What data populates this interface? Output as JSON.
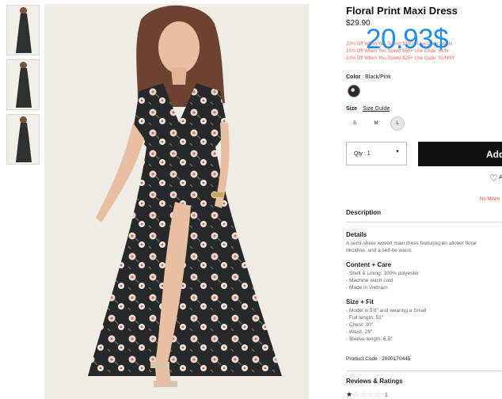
{
  "gallery": {
    "thumbnail_count": 3
  },
  "product": {
    "title": "Floral Print Maxi Dress",
    "price": "$29.90",
    "overlay_price": "20.93$",
    "promos": [
      "20% Off When You Spend $100+ Use Code: MAXI",
      "15% Off When You Spend $50+ Use Code: SUN",
      "10% Off When You Spend $25+ Use Code: SUNNY"
    ],
    "color_label": "Color",
    "color_value": ": Black/Pink",
    "size_label": "Size",
    "size_guide": "Size Guide",
    "sizes": [
      "S",
      "M",
      "L"
    ],
    "selected_size": "L",
    "quantity": "Qty : 1",
    "add_button": "Add",
    "wishlist_label": "A",
    "no_min": "No Minim",
    "description_heading": "Description",
    "details_heading": "Details",
    "details_lines": [
      "A semi-sheer woven maxi dress featuring an allover floral",
      "neckline, and a self-tie waist."
    ],
    "content_heading": "Content + Care",
    "content_lines": [
      "- Shell & Lining: 100% polyester",
      "- Machine wash cold",
      "- Made in Vietnam"
    ],
    "fit_heading": "Size + Fit",
    "fit_lines": [
      "- Model is 5'8\" and wearing a Small",
      "- Full length: 51\"",
      "- Chest: 30\"",
      "- Waist: 28\"",
      "- Sleeve length: 6.5\""
    ],
    "product_code": "Product Code : 2000170445",
    "reviews_heading": "Reviews & Ratings",
    "rating": 1,
    "rating_max": 5,
    "rating_count": "1"
  },
  "colors": {
    "overlay_price": "#1f8ef0",
    "promo": "#e8675c",
    "add_button_bg": "#111111",
    "no_min": "#e0443a"
  }
}
